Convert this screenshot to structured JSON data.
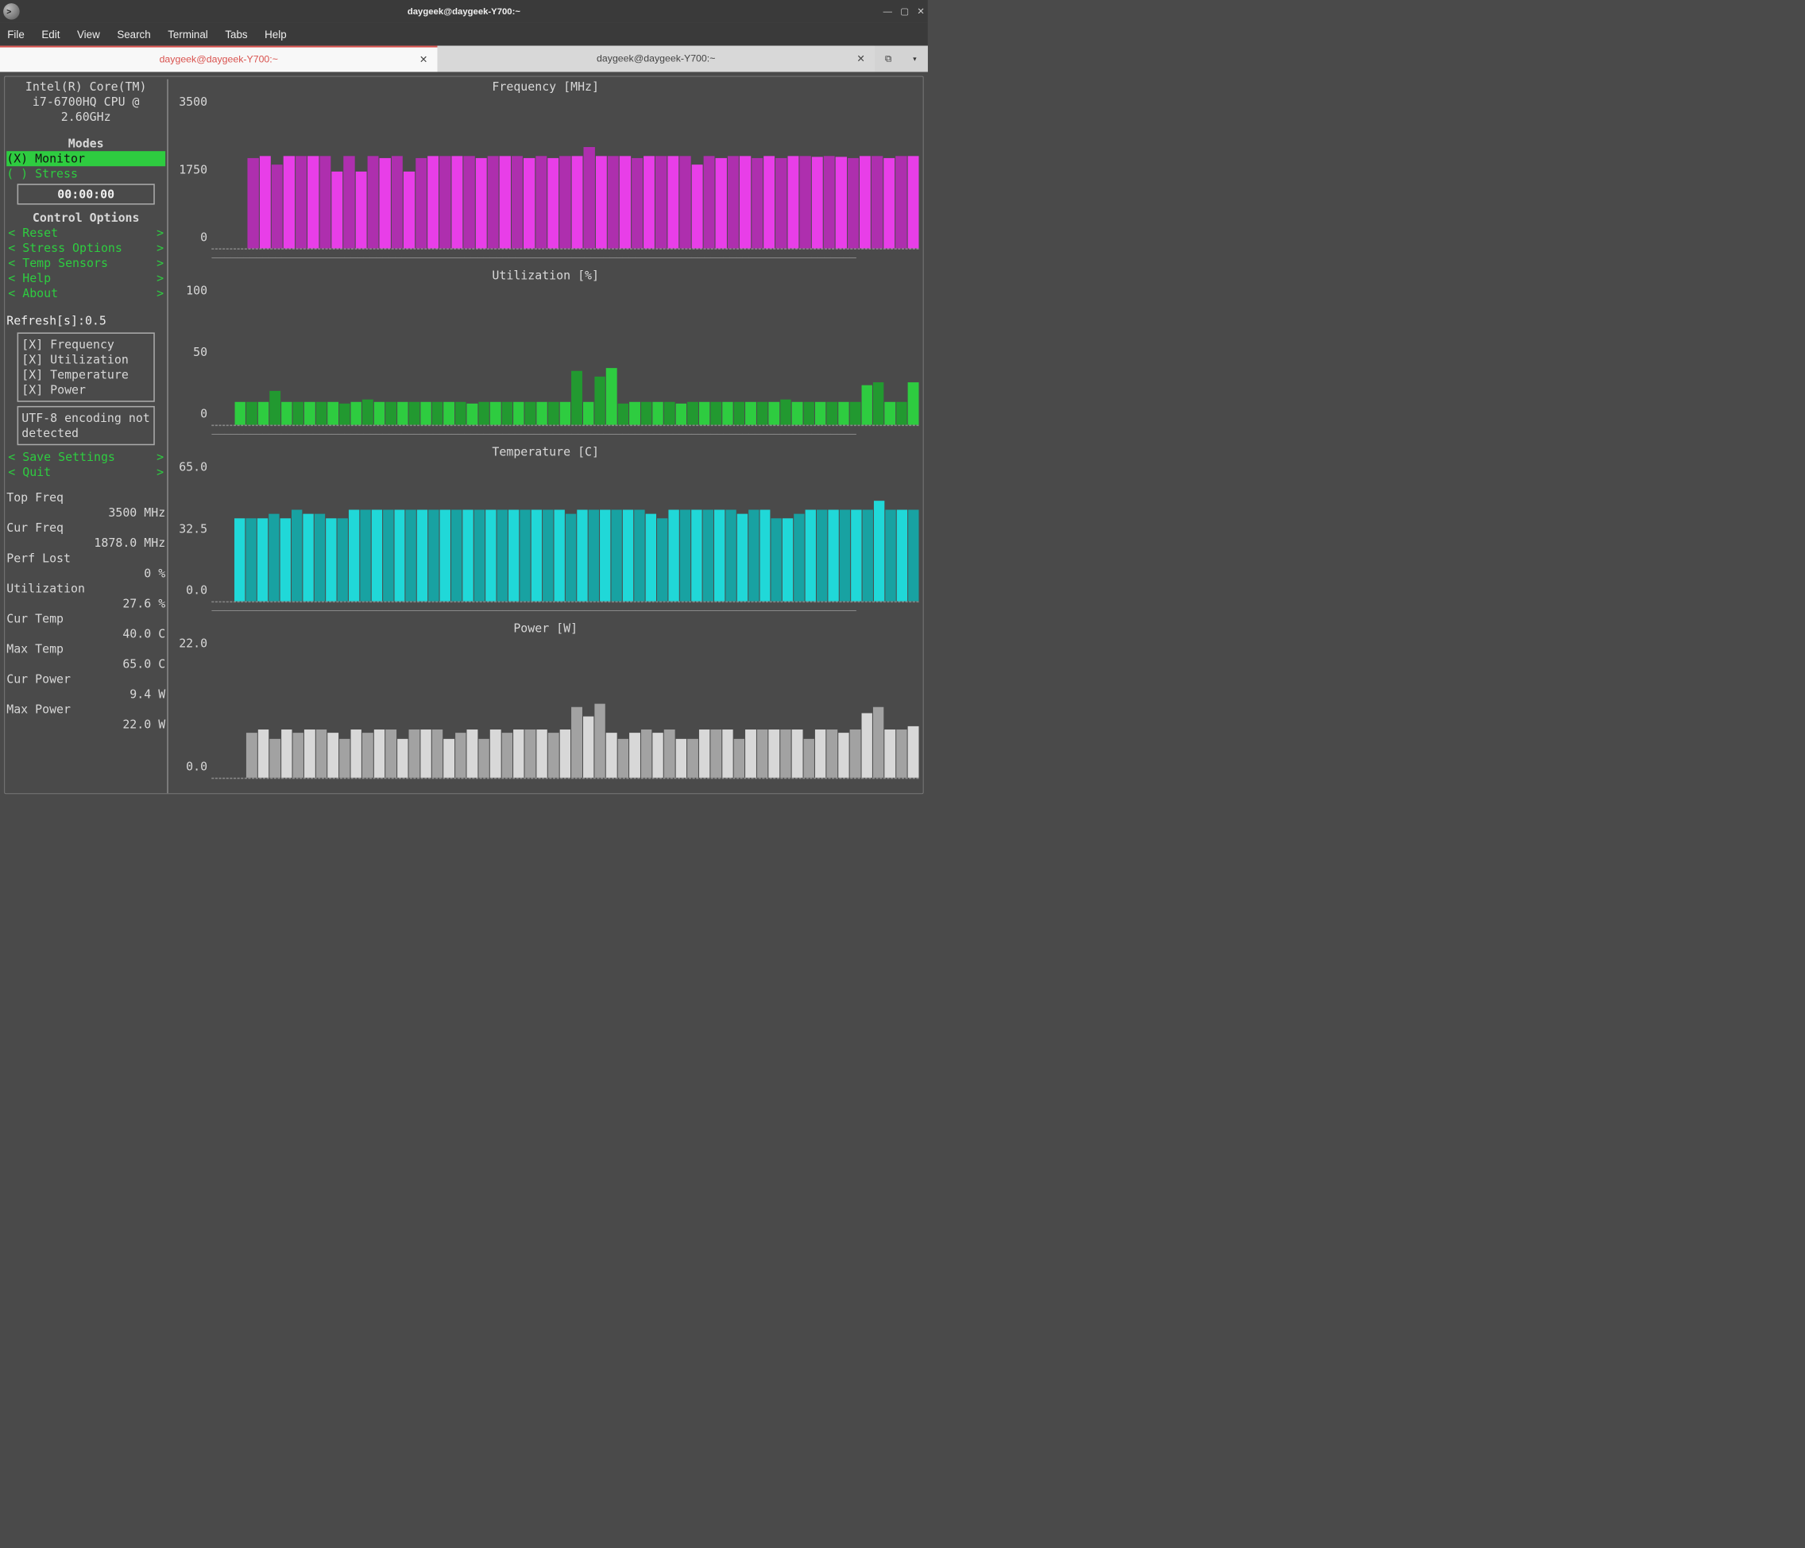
{
  "window": {
    "title": "daygeek@daygeek-Y700:~"
  },
  "menu": {
    "items": [
      "File",
      "Edit",
      "View",
      "Search",
      "Terminal",
      "Tabs",
      "Help"
    ]
  },
  "tabs": {
    "active": "daygeek@daygeek-Y700:~",
    "inactive": "daygeek@daygeek-Y700:~"
  },
  "cpu": {
    "line1": "Intel(R) Core(TM)",
    "line2": "i7-6700HQ CPU @",
    "line3": "2.60GHz"
  },
  "modes": {
    "title": "Modes",
    "monitor": "(X) Monitor",
    "stress": "( ) Stress"
  },
  "timer": "00:00:00",
  "control_options": {
    "title": "Control Options",
    "items": [
      "Reset",
      "Stress Options",
      "Temp Sensors",
      "Help",
      "About"
    ]
  },
  "refresh": {
    "label": "Refresh[s]:",
    "value": "0.5"
  },
  "plot_toggles": {
    "frequency": "[X] Frequency",
    "utilization": "[X] Utilization",
    "temperature": "[X] Temperature",
    "power": "[X] Power"
  },
  "utf8_warning": "UTF-8 encoding not detected",
  "bottom_options": {
    "save": "Save Settings",
    "quit": "Quit"
  },
  "stats": {
    "top_freq_label": "Top Freq",
    "top_freq_value": "3500 MHz",
    "cur_freq_label": "Cur Freq",
    "cur_freq_value": "1878.0 MHz",
    "perf_lost_label": "Perf Lost",
    "perf_lost_value": "0 %",
    "util_label": "Utilization",
    "util_value": "27.6 %",
    "cur_temp_label": "Cur Temp",
    "cur_temp_value": "40.0 C",
    "max_temp_label": "Max Temp",
    "max_temp_value": "65.0 C",
    "cur_power_label": "Cur Power",
    "cur_power_value": "9.4 W",
    "max_power_label": "Max Power",
    "max_power_value": "22.0 W"
  },
  "chart_data": [
    {
      "type": "bar",
      "title": "Frequency [MHz]",
      "ylim": [
        0,
        3500
      ],
      "yticks": [
        "3500",
        "1750",
        "0"
      ],
      "color": "#e83ee8",
      "values": [
        null,
        null,
        null,
        2050,
        2100,
        1900,
        2100,
        2100,
        2100,
        2100,
        1750,
        2100,
        1750,
        2100,
        2050,
        2100,
        1750,
        2050,
        2100,
        2100,
        2100,
        2100,
        2050,
        2100,
        2100,
        2100,
        2050,
        2100,
        2050,
        2100,
        2100,
        2300,
        2100,
        2100,
        2100,
        2050,
        2100,
        2100,
        2100,
        2100,
        1900,
        2100,
        2050,
        2100,
        2100,
        2050,
        2100,
        2050,
        2100,
        2100,
        2080,
        2100,
        2080,
        2050,
        2100,
        2100,
        2050,
        2100,
        2100
      ]
    },
    {
      "type": "bar",
      "title": "Utilization [%]",
      "ylim": [
        0,
        100
      ],
      "yticks": [
        "100",
        "50",
        "0"
      ],
      "color": "#2ecc40",
      "values": [
        null,
        null,
        16,
        16,
        16,
        24,
        16,
        16,
        16,
        16,
        16,
        15,
        16,
        18,
        16,
        16,
        16,
        16,
        16,
        16,
        16,
        16,
        15,
        16,
        16,
        16,
        16,
        16,
        16,
        16,
        16,
        38,
        16,
        34,
        40,
        15,
        16,
        16,
        16,
        16,
        15,
        16,
        16,
        16,
        16,
        16,
        16,
        16,
        16,
        18,
        16,
        16,
        16,
        16,
        16,
        16,
        28,
        30,
        16,
        16,
        30
      ]
    },
    {
      "type": "bar",
      "title": "Temperature [C]",
      "ylim": [
        0.0,
        65.0
      ],
      "yticks": [
        "65.0",
        "32.5",
        "0.0"
      ],
      "color": "#20d8d8",
      "values": [
        null,
        null,
        38,
        38,
        38,
        40,
        38,
        42,
        40,
        40,
        38,
        38,
        42,
        42,
        42,
        42,
        42,
        42,
        42,
        42,
        42,
        42,
        42,
        42,
        42,
        42,
        42,
        42,
        42,
        42,
        42,
        40,
        42,
        42,
        42,
        42,
        42,
        42,
        40,
        38,
        42,
        42,
        42,
        42,
        42,
        42,
        40,
        42,
        42,
        38,
        38,
        40,
        42,
        42,
        42,
        42,
        42,
        42,
        46,
        42,
        42,
        42
      ]
    },
    {
      "type": "bar",
      "title": "Power [W]",
      "ylim": [
        0.0,
        22.0
      ],
      "yticks": [
        "22.0",
        "",
        "0.0"
      ],
      "color": "#d8d8d8",
      "values": [
        null,
        null,
        null,
        7,
        7.5,
        6,
        7.5,
        7,
        7.5,
        7.5,
        7,
        6,
        7.5,
        7,
        7.5,
        7.5,
        6,
        7.5,
        7.5,
        7.5,
        6,
        7,
        7.5,
        6,
        7.5,
        7,
        7.5,
        7.5,
        7.5,
        7,
        7.5,
        11,
        9.5,
        11.5,
        7,
        6,
        7,
        7.5,
        7,
        7.5,
        6,
        6,
        7.5,
        7.5,
        7.5,
        6,
        7.5,
        7.5,
        7.5,
        7.5,
        7.5,
        6,
        7.5,
        7.5,
        7,
        7.5,
        10,
        11,
        7.5,
        7.5,
        8
      ]
    }
  ]
}
